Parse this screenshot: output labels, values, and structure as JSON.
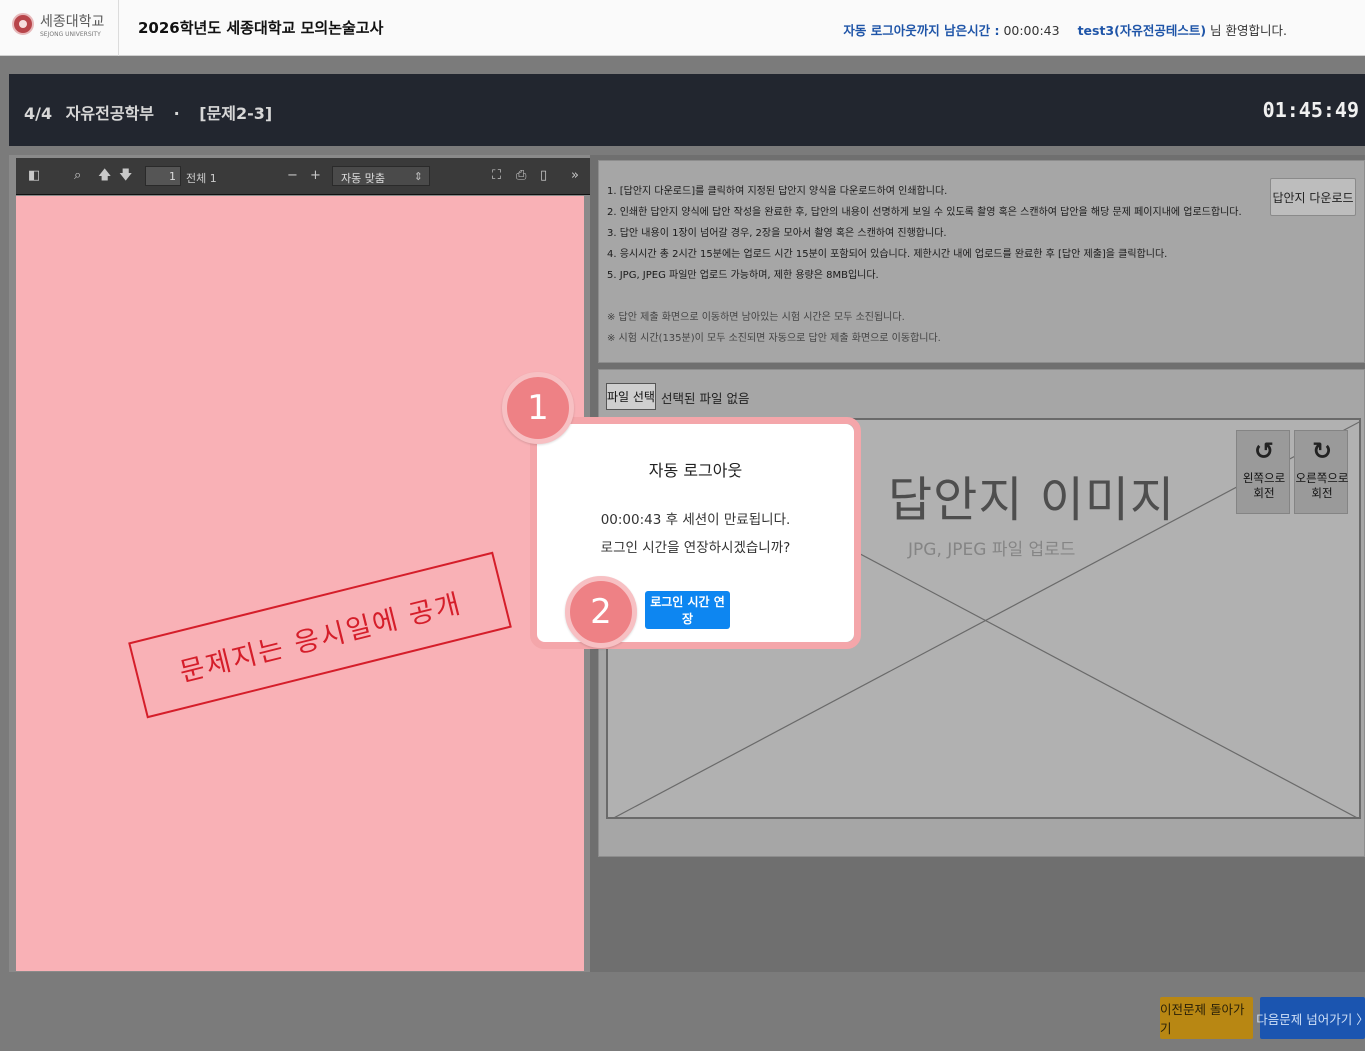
{
  "topbar": {
    "logo_kr": "세종대학교",
    "logo_en": "SEJONG UNIVERSITY",
    "exam_title": "2026학년도 세종대학교 모의논술고사",
    "logout_label": "자동 로그아웃까지 남은시간 :",
    "logout_time": "00:00:43",
    "user_name": "test3(자유전공테스트)",
    "welcome_suffix": "님 환영합니다."
  },
  "header": {
    "progress": "4/4",
    "department": "자유전공학부",
    "separator": "·",
    "question": "[문제2-3]",
    "timer": "01:45:49"
  },
  "pdf_toolbar": {
    "page_number": "1",
    "total_pages": "전체 1",
    "zoom_minus": "−",
    "zoom_plus": "+",
    "zoom_value": "자동 맞춤",
    "more": "»"
  },
  "pdf_page": {
    "stamp_text": "문제지는 응시일에 공개"
  },
  "instructions": {
    "lines": [
      "1. [답안지 다운로드]를 클릭하여 지정된 답안지 양식을 다운로드하여 인쇄합니다.",
      "2. 인쇄한 답안지 양식에 답안 작성을 완료한 후, 답안의 내용이 선명하게 보일 수 있도록 촬영 혹은 스캔하여 답안을 해당 문제 페이지내에 업로드합니다.",
      "3. 답안 내용이 1장이 넘어갈 경우, 2장을 모아서 촬영 혹은 스캔하여 진행합니다.",
      "4. 응시시간 총 2시간 15분에는 업로드 시간 15분이 포함되어 있습니다. 제한시간 내에 업로드를 완료한 후 [답안 제출]을 클릭합니다.",
      "5. JPG, JPEG 파일만 업로드 가능하며, 제한 용량은 8MB입니다."
    ],
    "notes": [
      "※ 답안 제출 화면으로 이동하면 남아있는 시험 시간은 모두 소진됩니다.",
      "※ 시험 시간(135분)이 모두 소진되면 자동으로 답안 제출 화면으로 이동합니다."
    ],
    "download_label": "답안지 다운로드"
  },
  "upload": {
    "file_button": "파일 선택",
    "file_status": "선택된 파일 없음",
    "image_title": "답안지 이미지",
    "image_sub": "JPG, JPEG 파일 업로드",
    "rotate_left_glyph": "↺",
    "rotate_left_label": "왼쪽으로\n회전",
    "rotate_right_glyph": "↻",
    "rotate_right_label": "오른쪽으로\n회전"
  },
  "nav": {
    "prev_label": "이전문제 돌아가기",
    "next_label": "다음문제 넘어가기 〉"
  },
  "modal": {
    "title": "자동 로그아웃",
    "message1": "00:00:43 후 세션이 만료됩니다.",
    "message2": "로그인 시간을 연장하시겠습니까?",
    "extend_label": "로그인 시간 연장"
  },
  "markers": {
    "first": "1",
    "second": "2"
  },
  "colors": {
    "accent_blue": "#0d86f1",
    "header_dark": "#22262f",
    "stamp_red": "#d51e2a",
    "pdf_page_pink": "#f9b1b6",
    "marker_pink": "#ee8185",
    "prev_button": "#b88713",
    "next_button": "#1b55b0"
  }
}
